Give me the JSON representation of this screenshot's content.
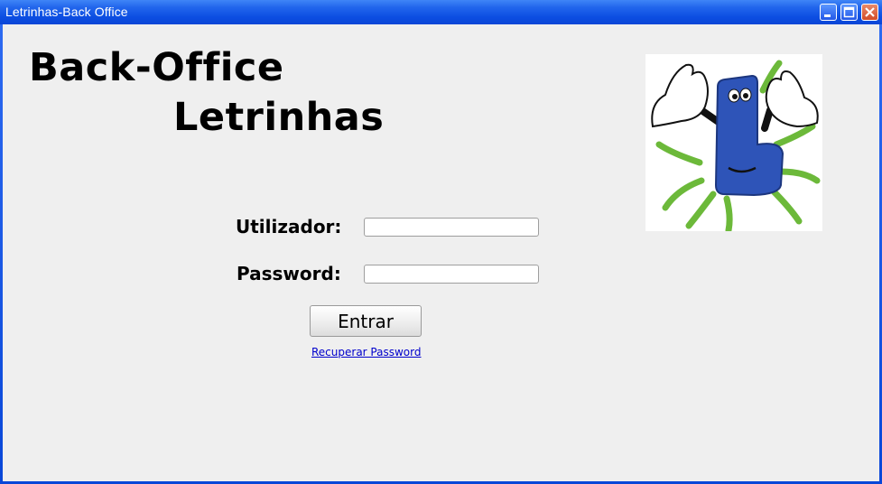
{
  "window": {
    "title": "Letrinhas-Back Office",
    "controls": {
      "minimize_icon": "minimize-icon",
      "maximize_icon": "maximize-icon",
      "close_icon": "close-icon"
    }
  },
  "header": {
    "line1": "Back-Office",
    "line2": "Letrinhas"
  },
  "logo": {
    "icon": "letrinhas-mascot-logo",
    "colors": {
      "letter": "#2e54b8",
      "rays": "#6cb93a"
    }
  },
  "form": {
    "username_label": "Utilizador:",
    "username_value": "",
    "password_label": "Password:",
    "password_value": "",
    "submit_label": "Entrar",
    "recover_link": "Recuperar Password"
  },
  "colors": {
    "titlebar": "#0a46d6",
    "client_bg": "#efefef",
    "link": "#0000cc"
  }
}
